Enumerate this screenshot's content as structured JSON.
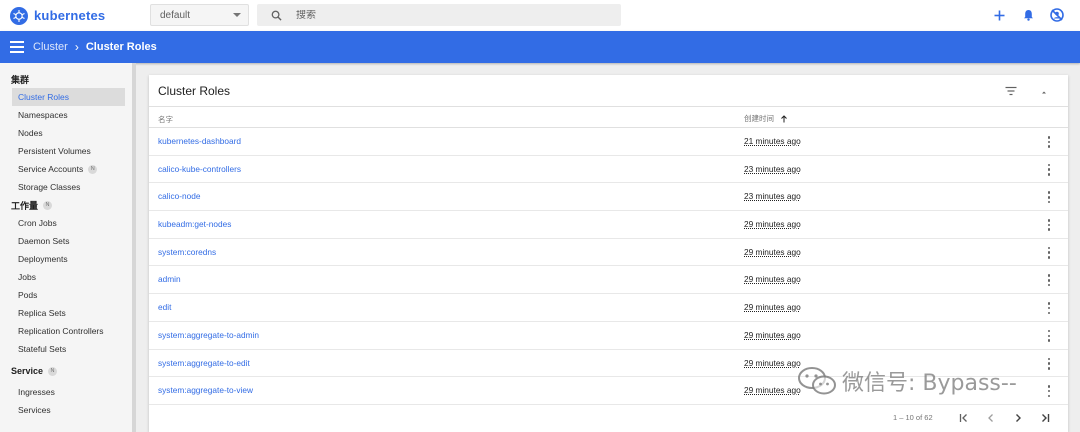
{
  "app": {
    "brand": "kubernetes"
  },
  "topbar": {
    "namespace": "default",
    "search_placeholder": "搜索"
  },
  "breadcrumb": {
    "parent": "Cluster",
    "current": "Cluster Roles"
  },
  "sidebar": {
    "sections": [
      {
        "title": "集群",
        "badge": "",
        "items": [
          {
            "label": "Cluster Roles",
            "active": true,
            "badge": ""
          },
          {
            "label": "Namespaces",
            "badge": ""
          },
          {
            "label": "Nodes",
            "badge": ""
          },
          {
            "label": "Persistent Volumes",
            "badge": ""
          },
          {
            "label": "Service Accounts",
            "badge": "N"
          },
          {
            "label": "Storage Classes",
            "badge": ""
          }
        ]
      },
      {
        "title": "工作量",
        "badge": "N",
        "items": [
          {
            "label": "Cron Jobs"
          },
          {
            "label": "Daemon Sets"
          },
          {
            "label": "Deployments"
          },
          {
            "label": "Jobs"
          },
          {
            "label": "Pods"
          },
          {
            "label": "Replica Sets"
          },
          {
            "label": "Replication Controllers"
          },
          {
            "label": "Stateful Sets"
          }
        ]
      },
      {
        "title": "Service",
        "badge": "N",
        "items": [
          {
            "label": "Ingresses"
          },
          {
            "label": "Services"
          }
        ]
      }
    ]
  },
  "card": {
    "title": "Cluster Roles",
    "columns": {
      "name": "名字",
      "created": "创建时间"
    },
    "rows": [
      {
        "name": "kubernetes-dashboard",
        "created": "21 minutes ago"
      },
      {
        "name": "calico-kube-controllers",
        "created": "23 minutes ago"
      },
      {
        "name": "calico-node",
        "created": "23 minutes ago"
      },
      {
        "name": "kubeadm:get-nodes",
        "created": "29 minutes ago"
      },
      {
        "name": "system:coredns",
        "created": "29 minutes ago"
      },
      {
        "name": "admin",
        "created": "29 minutes ago"
      },
      {
        "name": "edit",
        "created": "29 minutes ago"
      },
      {
        "name": "system:aggregate-to-admin",
        "created": "29 minutes ago"
      },
      {
        "name": "system:aggregate-to-edit",
        "created": "29 minutes ago"
      },
      {
        "name": "system:aggregate-to-view",
        "created": "29 minutes ago"
      }
    ],
    "pagination": "1 – 10 of 62"
  },
  "watermark": "微信号: Bypass--",
  "colors": {
    "primary": "#326ce5",
    "sidebar_bg": "#f5f5f5",
    "page_bg": "#eeeeee"
  }
}
